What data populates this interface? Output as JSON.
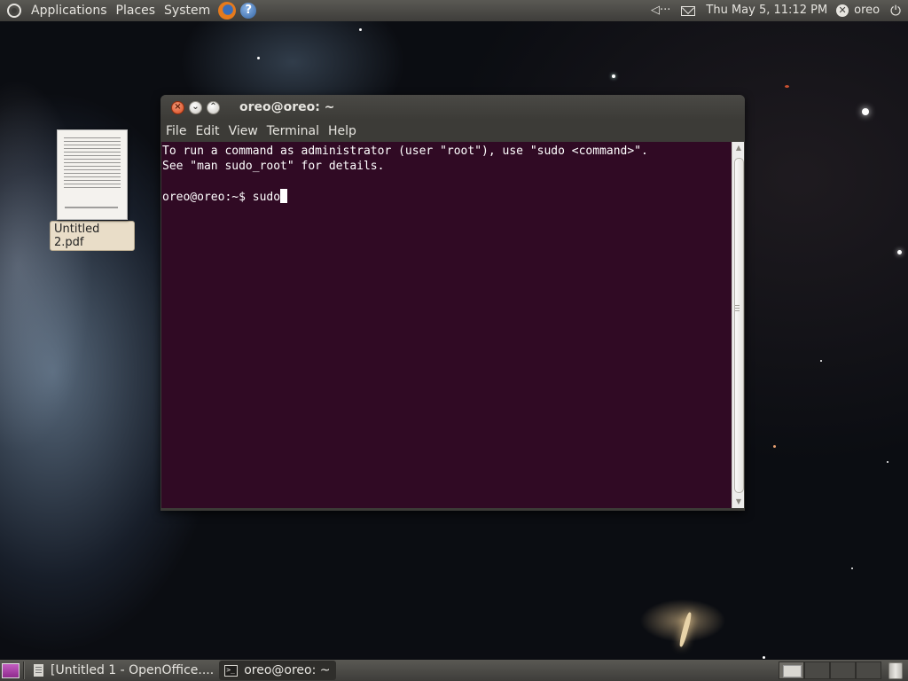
{
  "top_panel": {
    "menus": [
      "Applications",
      "Places",
      "System"
    ],
    "clock": "Thu May  5, 11:12 PM",
    "user": "oreo"
  },
  "desktop": {
    "icons": [
      {
        "label": "Untitled 2.pdf",
        "icon": "pdf-document-icon"
      }
    ]
  },
  "terminal": {
    "title": "oreo@oreo: ~",
    "menus": [
      "File",
      "Edit",
      "View",
      "Terminal",
      "Help"
    ],
    "lines": [
      "To run a command as administrator (user \"root\"), use \"sudo <command>\".",
      "See \"man sudo_root\" for details.",
      "",
      "oreo@oreo:~$ sudo"
    ],
    "background_color": "#300a24"
  },
  "bottom_panel": {
    "tasks": [
      {
        "label": "[Untitled 1 - OpenOffice....",
        "icon": "document-icon",
        "active": false
      },
      {
        "label": "oreo@oreo: ~",
        "icon": "terminal-icon",
        "active": true
      }
    ],
    "workspaces": 4
  }
}
